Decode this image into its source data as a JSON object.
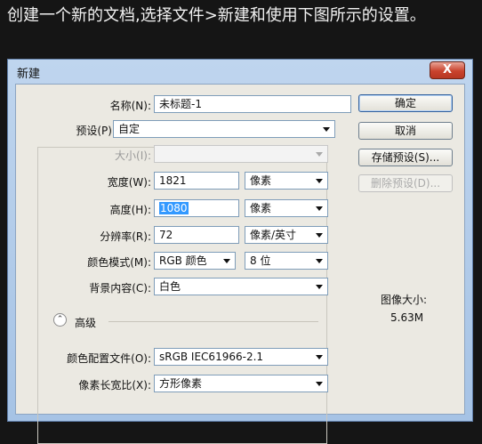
{
  "caption": "创建一个新的文档,选择文件>新建和使用下图所示的设置。",
  "window": {
    "title": "新建",
    "close_label": "X"
  },
  "form": {
    "name_label": "名称(N):",
    "name_value": "未标题-1",
    "preset_label": "预设(P):",
    "preset_value": "自定",
    "size_label": "大小(I):",
    "size_value": "",
    "width_label": "宽度(W):",
    "width_value": "1821",
    "width_unit": "像素",
    "height_label": "高度(H):",
    "height_value": "1080",
    "height_unit": "像素",
    "resolution_label": "分辨率(R):",
    "resolution_value": "72",
    "resolution_unit": "像素/英寸",
    "color_mode_label": "颜色模式(M):",
    "color_mode_value": "RGB 颜色",
    "bit_depth_value": "8 位",
    "background_label": "背景内容(C):",
    "background_value": "白色",
    "advanced_label": "高级",
    "color_profile_label": "颜色配置文件(O):",
    "color_profile_value": "sRGB IEC61966-2.1",
    "pixel_aspect_label": "像素长宽比(X):",
    "pixel_aspect_value": "方形像素",
    "toggle_icon": "double-up-chevron-icon"
  },
  "buttons": {
    "ok": "确定",
    "cancel": "取消",
    "save_preset": "存储预设(S)...",
    "delete_preset": "删除预设(D)..."
  },
  "image_size": {
    "label": "图像大小:",
    "value": "5.63M"
  },
  "colors": {
    "title_gradient_top": "#bfd5ee",
    "title_gradient_bottom": "#a6c3e5",
    "dialog_body": "#ebe9e2",
    "selection": "#3399ff",
    "close_button": "#c9432d"
  }
}
